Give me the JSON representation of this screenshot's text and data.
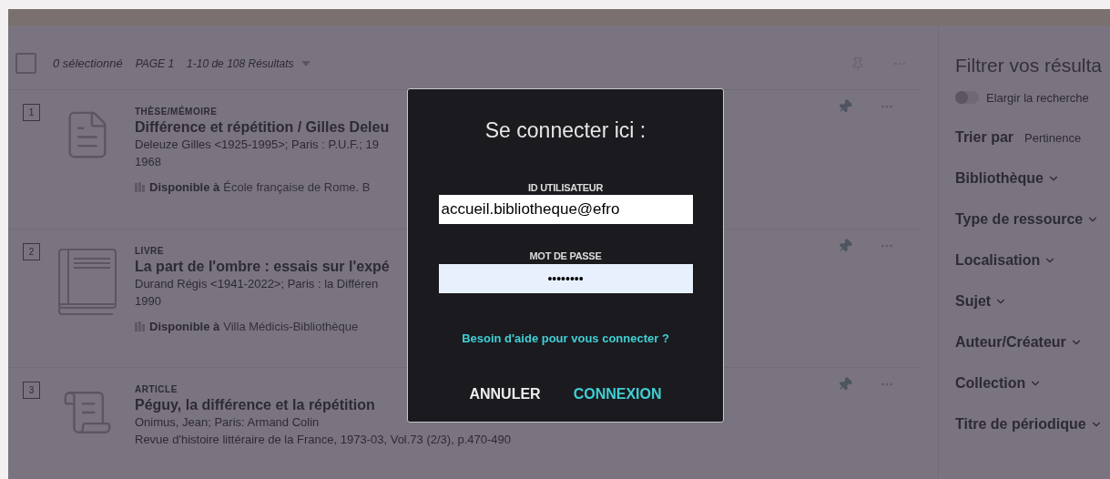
{
  "toolbar": {
    "checked": false,
    "selection": "0 sélectionné",
    "page": "PAGE 1",
    "results": "1-10 de 108 Résultats"
  },
  "records": [
    {
      "number": "1",
      "kind": "thesis",
      "type": "THÈSE/MÉMOIRE",
      "title": "Différence et répétition / Gilles Deleu",
      "authors": "Deleuze Gilles <1925-1995>; Paris : P.U.F.; 19",
      "date": "1968",
      "availability": "Disponible à",
      "location": "École française de Rome. B",
      "pinned": true
    },
    {
      "number": "2",
      "kind": "book",
      "type": "LIVRE",
      "title": "La part de l'ombre : essais sur l'expé",
      "authors": "Durand Régis <1941-2022>; Paris : la Différen",
      "date": "1990",
      "availability": "Disponible à",
      "location": "Villa Médicis-Bibliothèque",
      "pinned": true
    },
    {
      "number": "3",
      "kind": "article",
      "type": "ARTICLE",
      "title": "Péguy, la différence et la répétition",
      "authors": "Onimus, Jean; Paris: Armand Colin",
      "date": "Revue d'histoire littéraire de la France, 1973-03, Vol.73 (2/3), p.470-490",
      "pinned": true
    }
  ],
  "filters": {
    "heading": "Filtrer vos résulta",
    "expand_toggle": {
      "label": "Elargir la recherche",
      "on": false
    },
    "sort_label": "Trier par",
    "sort_value": "Pertinence",
    "facets": [
      "Bibliothèque",
      "Type de ressource",
      "Localisation",
      "Sujet",
      "Auteur/Créateur",
      "Collection",
      "Titre de périodique"
    ]
  },
  "login_dialog": {
    "title": "Se connecter ici :",
    "user_label": "ID UTILISATEUR",
    "user_value": "accueil.bibliotheque@efro",
    "password_label": "MOT DE PASSE",
    "password_value": "••••••••",
    "help_link": "Besoin d'aide pour vous connecter ?",
    "buttons": [
      {
        "label": "ANNULER",
        "kind": "cancel"
      },
      {
        "label": "CONNEXION",
        "kind": "primary"
      }
    ]
  }
}
